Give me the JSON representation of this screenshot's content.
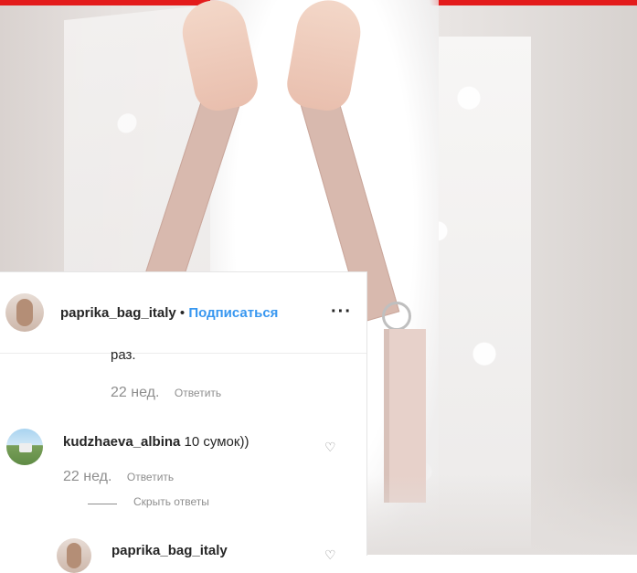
{
  "post": {
    "username": "paprika_bag_italy",
    "separator": "•",
    "follow_label": "Подписаться",
    "more_label": "···"
  },
  "comments": [
    {
      "text_fragment": "раз.",
      "time": "22 нед.",
      "reply_label": "Ответить"
    },
    {
      "username": "kudzhaeva_albina",
      "text": " 10 сумок))",
      "time": "22 нед.",
      "reply_label": "Ответить",
      "hide_replies_label": "Скрыть ответы"
    },
    {
      "username": "paprika_bag_italy"
    }
  ],
  "icons": {
    "heart": "♡"
  },
  "colors": {
    "accent": "#3897f0",
    "top_bar": "#e31b1b"
  }
}
